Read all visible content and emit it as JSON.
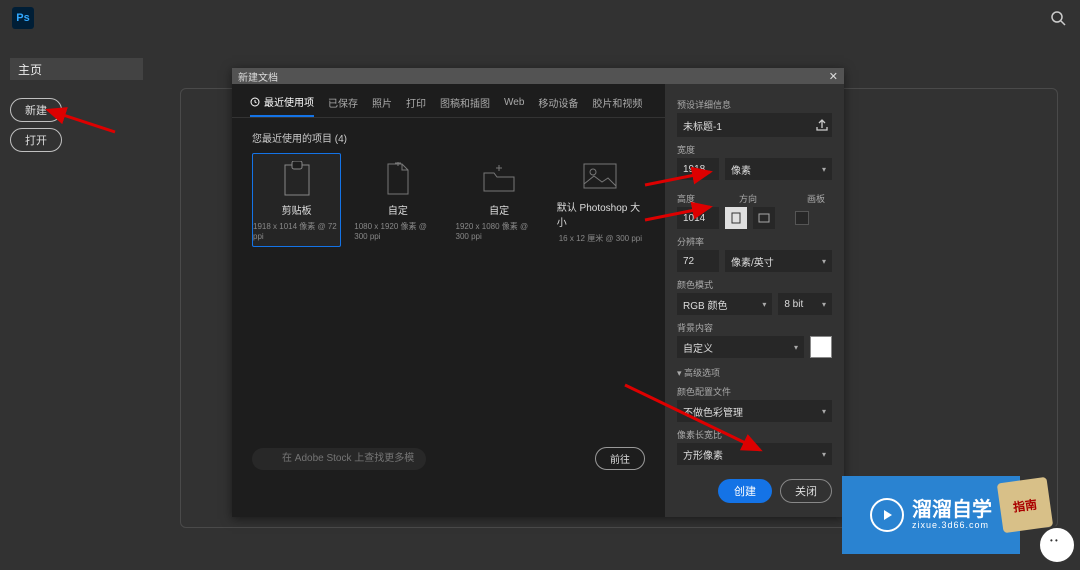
{
  "topbar": {
    "logo": "Ps"
  },
  "sidebar": {
    "home": "主页",
    "new": "新建",
    "open": "打开"
  },
  "dialog": {
    "title": "新建文档",
    "tabs": [
      "最近使用项",
      "已保存",
      "照片",
      "打印",
      "图稿和插图",
      "Web",
      "移动设备",
      "胶片和视频"
    ],
    "recent_label": "您最近使用的项目",
    "recent_count": "(4)",
    "presets": [
      {
        "name": "剪贴板",
        "sub": "1918 x 1014 像素 @ 72 ppi"
      },
      {
        "name": "自定",
        "sub": "1080 x 1920 像素 @ 300 ppi"
      },
      {
        "name": "自定",
        "sub": "1920 x 1080 像素 @ 300 ppi"
      },
      {
        "name": "默认 Photoshop 大小",
        "sub": "16 x 12 厘米 @ 300 ppi"
      }
    ],
    "stock_placeholder": "在 Adobe Stock 上查找更多模板",
    "stock_go": "前往"
  },
  "details": {
    "header": "预设详细信息",
    "doc_name": "未标题-1",
    "width_label": "宽度",
    "width_value": "1918",
    "width_unit": "像素",
    "height_label": "高度",
    "height_value": "1014",
    "orient_label": "方向",
    "artboard_label": "画板",
    "res_label": "分辨率",
    "res_value": "72",
    "res_unit": "像素/英寸",
    "colormode_label": "颜色模式",
    "colormode_value": "RGB 颜色",
    "bitdepth": "8 bit",
    "bgcontent_label": "背景内容",
    "bgcontent_value": "自定义",
    "advanced": "高级选项",
    "profile_label": "颜色配置文件",
    "profile_value": "不做色彩管理",
    "pixelaspect_label": "像素长宽比",
    "pixelaspect_value": "方形像素",
    "create": "创建",
    "close": "关闭"
  },
  "watermark": {
    "brand": "溜溜自学",
    "url": "zixue.3d66.com"
  },
  "guide_badge": "指南"
}
